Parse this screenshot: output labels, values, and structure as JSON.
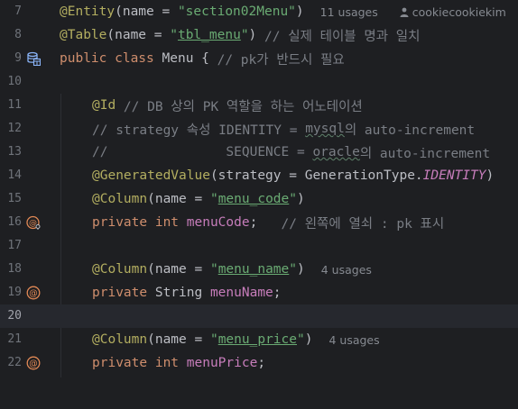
{
  "line_numbers": [
    "7",
    "8",
    "9",
    "10",
    "11",
    "12",
    "13",
    "14",
    "15",
    "16",
    "17",
    "18",
    "19",
    "20",
    "21",
    "22"
  ],
  "gutter_icons": {
    "line9": "database-table-icon",
    "line16": "primary-key-field-icon",
    "line19": "field-annotation-icon",
    "line22": "field-annotation-icon"
  },
  "lines": {
    "l7": {
      "annotation": "@Entity",
      "open": "(name = ",
      "string": "\"section02Menu\"",
      "close": ")",
      "usages": "11 usages",
      "author": "cookiecookiekim"
    },
    "l8": {
      "annotation": "@Table",
      "open": "(name = ",
      "q1": "\"",
      "string": "tbl_menu",
      "q2": "\"",
      "close": ") ",
      "comment": "// 실제 테이블 명과 일치"
    },
    "l9": {
      "kw": "public class ",
      "name": "Menu { ",
      "comment": "// pk가 반드시 필요"
    },
    "l11": {
      "annotation": "@Id",
      "comment": " // DB 상의 PK 역할을 하는 어노테이션"
    },
    "l12": {
      "c1": "// strategy 속성 IDENTITY = ",
      "c2": "mysql",
      "c3": "의 auto-increment"
    },
    "l13": {
      "c1": "//               SEQUENCE = ",
      "c2": "oracle",
      "c3": "의 auto-increment"
    },
    "l14": {
      "annotation": "@GeneratedValue",
      "open": "(strategy = GenerationType.",
      "const": "IDENTITY",
      "close": ")"
    },
    "l15": {
      "annotation": "@Column",
      "open": "(name = ",
      "q1": "\"",
      "string": "menu_code",
      "q2": "\"",
      "close": ")"
    },
    "l16": {
      "kw": "private int ",
      "field": "menuCode",
      "semi": ";   ",
      "comment": "// 왼쪽에 열쇠 : pk 표시"
    },
    "l18": {
      "annotation": "@Column",
      "open": "(name = ",
      "q1": "\"",
      "string": "menu_name",
      "q2": "\"",
      "close": ")",
      "usages": "4 usages"
    },
    "l19": {
      "kw": "private ",
      "type": "String ",
      "field": "menuName",
      "semi": ";"
    },
    "l21": {
      "annotation": "@Column",
      "open": "(name = ",
      "q1": "\"",
      "string": "menu_price",
      "q2": "\"",
      "close": ")",
      "usages": "4 usages"
    },
    "l22": {
      "kw": "private int ",
      "field": "menuPrice",
      "semi": ";"
    }
  }
}
